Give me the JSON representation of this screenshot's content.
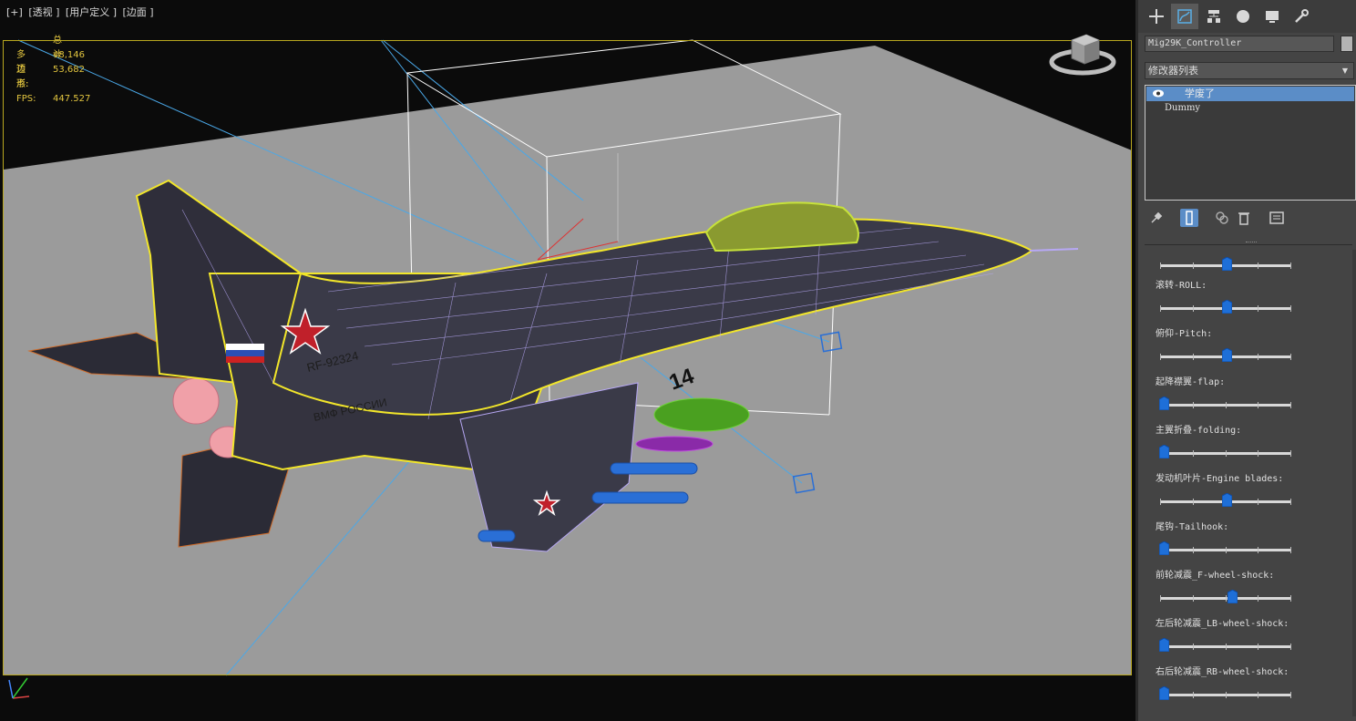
{
  "viewport": {
    "labels": [
      "[+]",
      "[透视 ]",
      "[用户定义 ]",
      "[边面 ]"
    ],
    "stats": {
      "header": "总计",
      "polygons_label": "多边形:",
      "polygons_value": "48,146",
      "vertices_label": "顶点:",
      "vertices_value": "53,682",
      "fps_label": "FPS:",
      "fps_value": "447.527"
    },
    "aircraft_markings": {
      "tail_code": "RF-92324",
      "side_number": "14",
      "fuselage_text": "ВМФ РОССИИ"
    },
    "colors": {
      "ground": "#9b9b9b",
      "background": "#0b0b0b",
      "border": "#b9a81f",
      "wireframe": "#b7a8f5",
      "selection": "#f2e62a",
      "canopy": "#c7e23a",
      "tank": "#6fd13a",
      "missile": "#2a6fd6",
      "tail_orange": "#d06c2a",
      "nozzle_pink": "#f0a0a8",
      "helper_line": "#4aa8e8"
    }
  },
  "panel": {
    "tabs": [
      {
        "icon": "plus-icon",
        "active": false
      },
      {
        "icon": "modify-icon",
        "active": true
      },
      {
        "icon": "hierarchy-icon",
        "active": false
      },
      {
        "icon": "motion-icon",
        "active": false
      },
      {
        "icon": "display-icon",
        "active": false
      },
      {
        "icon": "utilities-icon",
        "active": false
      }
    ],
    "object_name": "Mig29K_Controller",
    "modifier_list_label": "修改器列表",
    "stack": [
      {
        "label": "学废了",
        "selected": true
      },
      {
        "label": "Dummy",
        "selected": false
      }
    ],
    "params": [
      {
        "label": "",
        "value": 0.5
      },
      {
        "label": "滚转-ROLL:",
        "value": 0.5
      },
      {
        "label": "俯仰-Pitch:",
        "value": 0.5
      },
      {
        "label": "起降襟翼-flap:",
        "value": 0.0
      },
      {
        "label": "主翼折叠-folding:",
        "value": 0.0
      },
      {
        "label": "发动机叶片-Engine blades:",
        "value": 0.5
      },
      {
        "label": "尾钩-Tailhook:",
        "value": 0.0
      },
      {
        "label": "前轮减震_F-wheel-shock:",
        "value": 0.54
      },
      {
        "label": "左后轮减震_LB-wheel-shock:",
        "value": 0.0
      },
      {
        "label": "右后轮减震_RB-wheel-shock:",
        "value": 0.0
      }
    ]
  }
}
